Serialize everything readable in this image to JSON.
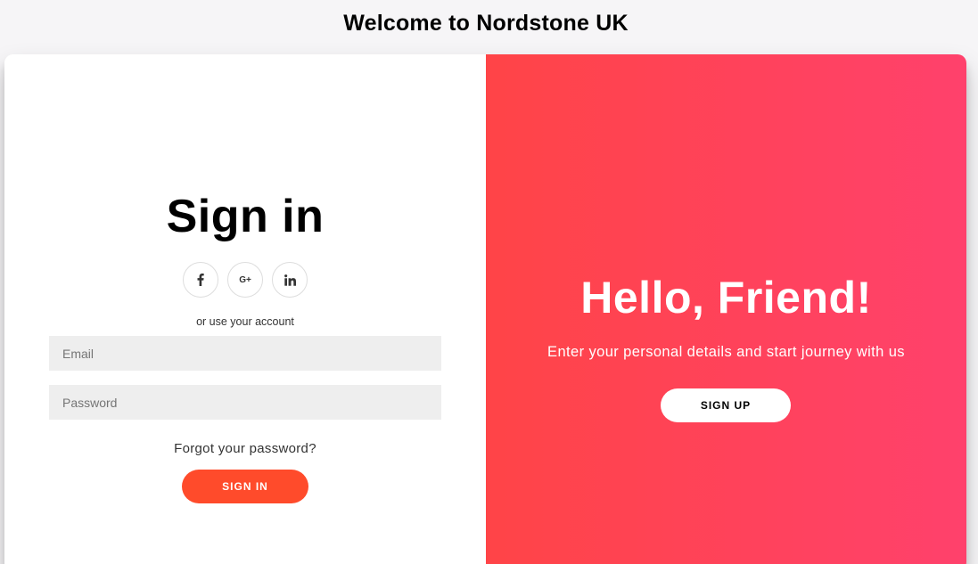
{
  "page": {
    "title": "Welcome to Nordstone UK"
  },
  "sign_in": {
    "heading": "Sign in",
    "social": [
      {
        "icon": "facebook-icon"
      },
      {
        "icon": "google-plus-icon",
        "text": "G+"
      },
      {
        "icon": "linkedin-icon"
      }
    ],
    "alt_text": "or use your account",
    "email_placeholder": "Email",
    "password_placeholder": "Password",
    "forgot_label": "Forgot your password?",
    "button_label": "SIGN IN"
  },
  "overlay": {
    "heading": "Hello, Friend!",
    "text": "Enter your personal details and start journey with us",
    "button_label": "SIGN UP"
  },
  "colors": {
    "primary": "#ff4b2b",
    "gradient_start": "#ff4447",
    "gradient_end": "#ff416c",
    "input_bg": "#eeeeee",
    "page_bg": "#f6f5f7"
  }
}
